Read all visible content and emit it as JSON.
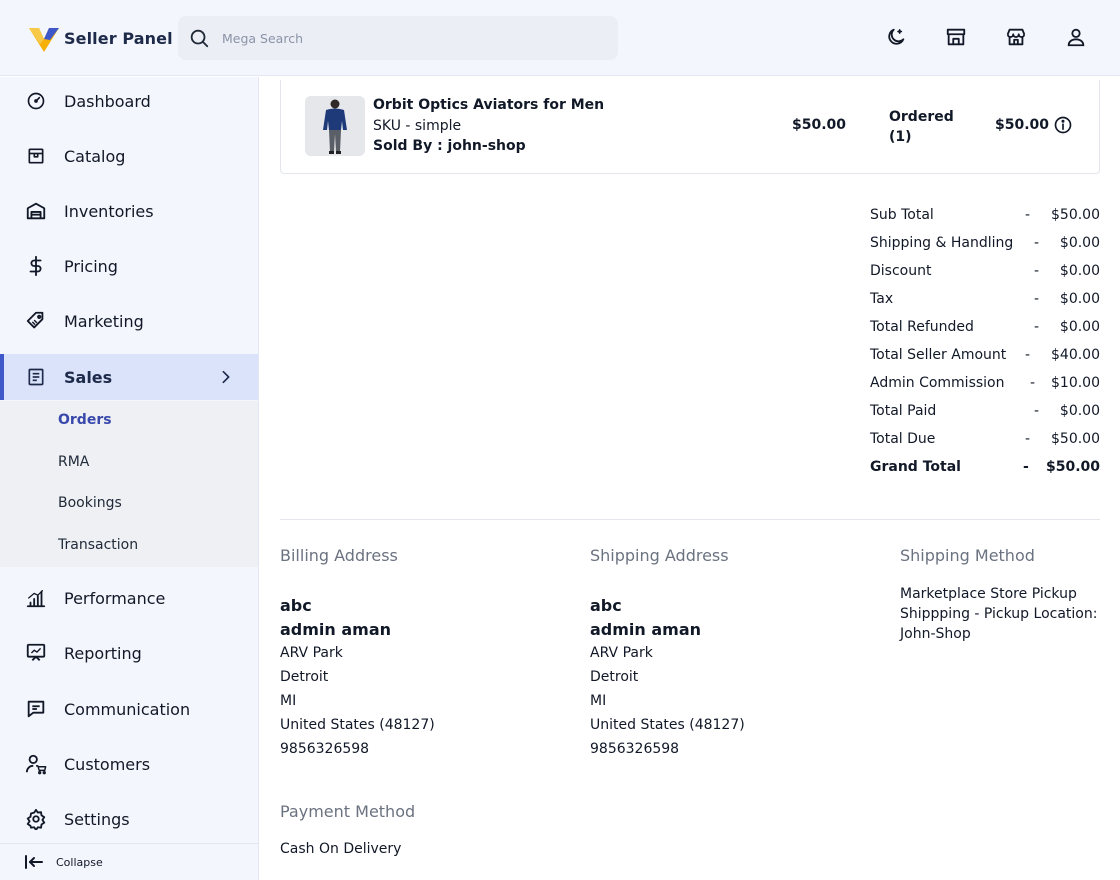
{
  "header": {
    "brand": "Seller Panel",
    "search_placeholder": "Mega Search",
    "icons": [
      "moon-icon",
      "store-icon",
      "shop-icon",
      "user-icon"
    ],
    "accent": "#3e58c9",
    "logo_colors": [
      "#f5b10a",
      "#3e58c9"
    ]
  },
  "sidebar": {
    "items": [
      {
        "label": "Dashboard",
        "icon": "gauge-icon"
      },
      {
        "label": "Catalog",
        "icon": "box-icon"
      },
      {
        "label": "Inventories",
        "icon": "warehouse-icon"
      },
      {
        "label": "Pricing",
        "icon": "dollar-icon"
      },
      {
        "label": "Marketing",
        "icon": "tag-icon"
      },
      {
        "label": "Sales",
        "icon": "document-icon",
        "active": true
      },
      {
        "label": "Performance",
        "icon": "bar-chart-icon"
      },
      {
        "label": "Reporting",
        "icon": "presentation-icon"
      },
      {
        "label": "Communication",
        "icon": "chat-icon"
      },
      {
        "label": "Customers",
        "icon": "customer-cart-icon"
      },
      {
        "label": "Settings",
        "icon": "gear-icon"
      }
    ],
    "sales_submenu": [
      "Orders",
      "RMA",
      "Bookings",
      "Transaction"
    ],
    "active_submenu": "Orders",
    "collapse_label": "Collapse"
  },
  "order_item": {
    "name": "Orbit Optics Aviators for Men",
    "sku": "SKU - simple",
    "sold_by": "Sold By : john-shop",
    "price": "$50.00",
    "status": "Ordered",
    "qty": "(1)",
    "total": "$50.00"
  },
  "summary": [
    {
      "label": "Sub Total",
      "value": "$50.00"
    },
    {
      "label": "Shipping & Handling",
      "value": "$0.00"
    },
    {
      "label": "Discount",
      "value": "$0.00"
    },
    {
      "label": "Tax",
      "value": "$0.00"
    },
    {
      "label": "Total Refunded",
      "value": "$0.00"
    },
    {
      "label": "Total Seller Amount",
      "value": "$40.00"
    },
    {
      "label": "Admin Commission",
      "value": "$10.00"
    },
    {
      "label": "Total Paid",
      "value": "$0.00"
    },
    {
      "label": "Total Due",
      "value": "$50.00"
    },
    {
      "label": "Grand Total",
      "value": "$50.00",
      "bold": true
    }
  ],
  "summary_separator": "-",
  "billing": {
    "title": "Billing Address",
    "company": "abc",
    "name": "admin aman",
    "lines": [
      "ARV Park",
      "Detroit",
      "MI",
      "United States (48127)",
      "9856326598"
    ]
  },
  "shipping": {
    "title": "Shipping Address",
    "company": "abc",
    "name": "admin aman",
    "lines": [
      "ARV Park",
      "Detroit",
      "MI",
      "United States (48127)",
      "9856326598"
    ]
  },
  "shipping_method": {
    "title": "Shipping Method",
    "lines": [
      "Marketplace Store Pickup",
      "Shippping - Pickup Location:",
      "John-Shop"
    ]
  },
  "payment": {
    "title": "Payment Method",
    "value": "Cash On Delivery"
  }
}
